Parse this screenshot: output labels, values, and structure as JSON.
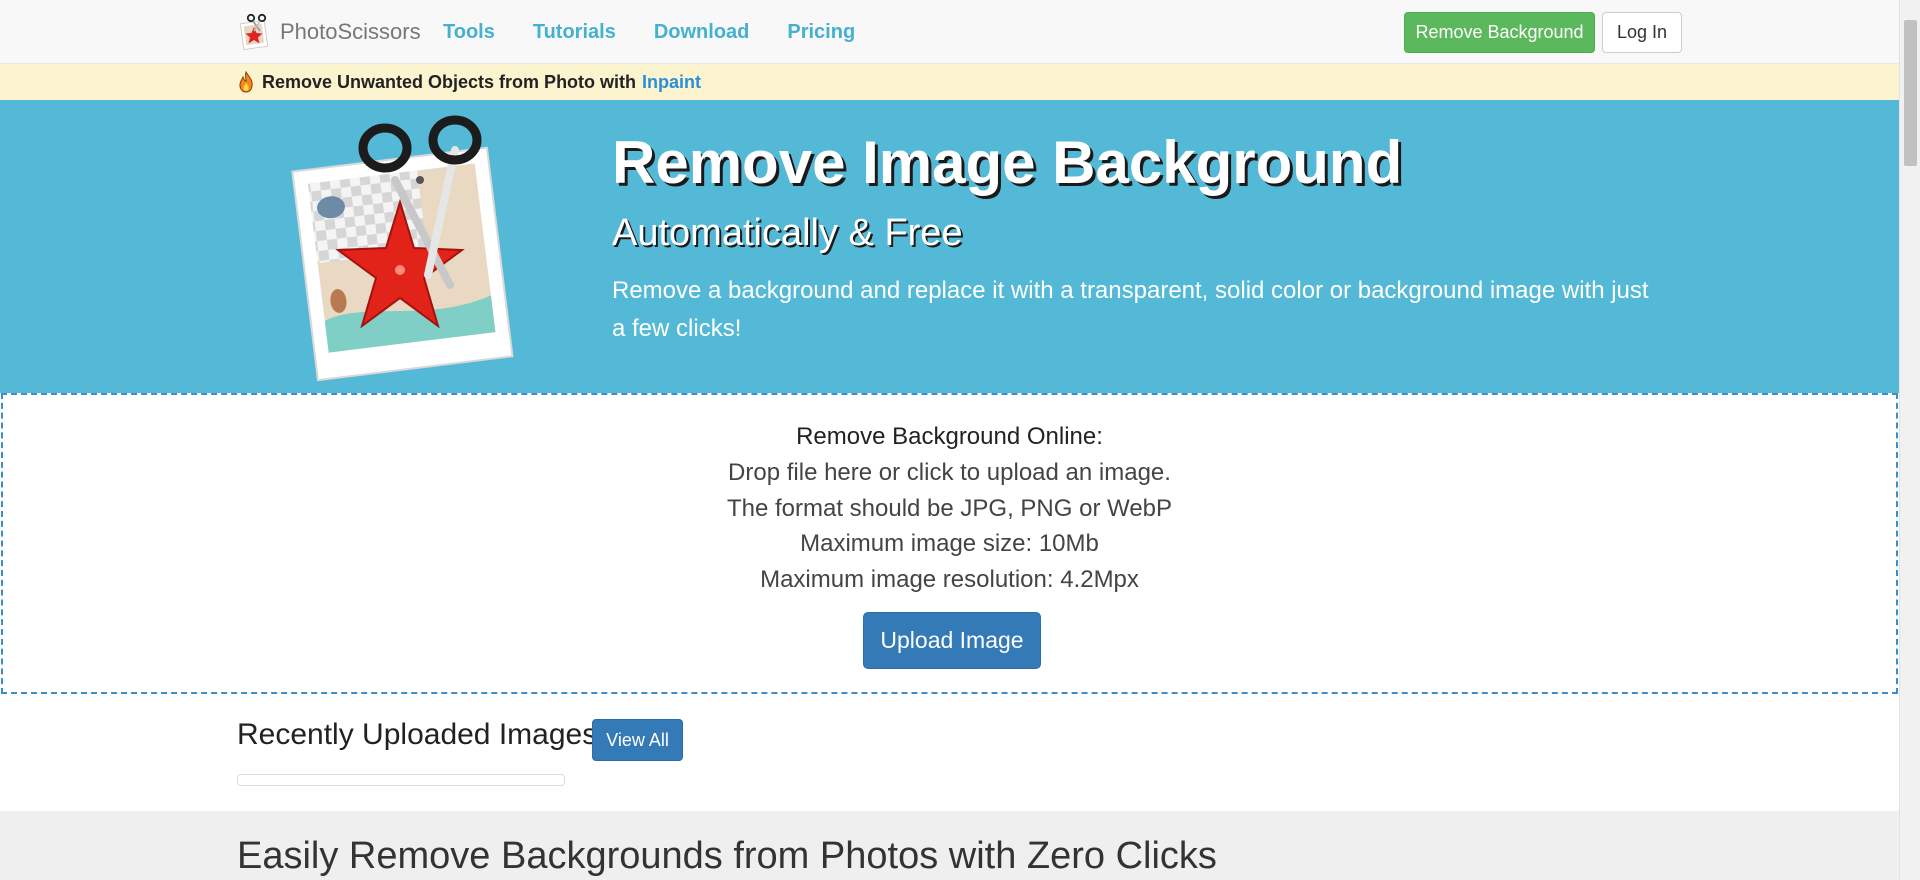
{
  "navbar": {
    "brand": "PhotoScissors",
    "links": [
      "Tools",
      "Tutorials",
      "Download",
      "Pricing"
    ],
    "remove_background_button": "Remove Background",
    "login_button": "Log In"
  },
  "promo": {
    "text": "Remove Unwanted Objects from Photo with",
    "link": "Inpaint"
  },
  "hero": {
    "title": "Remove Image Background",
    "subtitle": "Automatically & Free",
    "description": "Remove a background and replace it with a transparent, solid color or background image with just a few clicks!"
  },
  "upload": {
    "title": "Remove Background Online:",
    "line1": "Drop file here or click to upload an image.",
    "line2": "The format should be JPG, PNG or WebP",
    "line3": "Maximum image size: 10Mb",
    "line4": "Maximum image resolution: 4.2Mpx",
    "button": "Upload Image"
  },
  "recent": {
    "title": "Recently Uploaded Images",
    "view_all": "View All"
  },
  "bottom": {
    "heading": "Easily Remove Backgrounds from Photos with Zero Clicks"
  },
  "icons": {
    "brand": "scissors-star-logo-icon",
    "promo": "fire-icon",
    "hero": "photo-scissors-starfish-icon"
  },
  "colors": {
    "hero_bg": "#54b9d6",
    "nav_link": "#45b0d0",
    "success": "#5cb85c",
    "primary": "#337ab7",
    "promo_bg": "#fcf3cf",
    "promo_link": "#2a8fd8"
  }
}
